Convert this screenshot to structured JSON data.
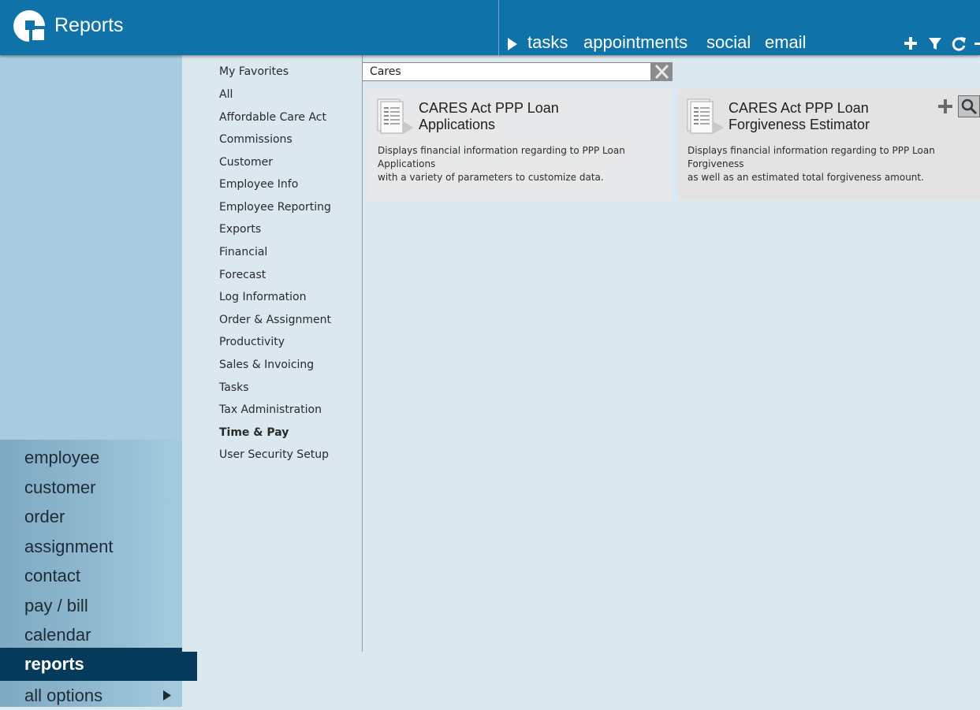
{
  "header": {
    "title": "Reports",
    "links": [
      "tasks",
      "appointments",
      "social",
      "email"
    ],
    "icons": [
      "play-icon",
      "plus-icon",
      "filter-icon",
      "refresh-icon"
    ]
  },
  "nav": {
    "items": [
      {
        "label": "employee"
      },
      {
        "label": "customer"
      },
      {
        "label": "order"
      },
      {
        "label": "assignment"
      },
      {
        "label": "contact"
      },
      {
        "label": "pay / bill"
      },
      {
        "label": "calendar"
      },
      {
        "label": "reports",
        "active": true
      },
      {
        "label": "all options"
      }
    ]
  },
  "categories": [
    "My Favorites",
    "All",
    "Affordable Care Act",
    "Commissions",
    "Customer",
    "Employee Info",
    "Employee Reporting",
    "Exports",
    "Financial",
    "Forecast",
    "Log Information",
    "Order & Assignment",
    "Productivity",
    "Sales & Invoicing",
    "Tasks",
    "Tax Administration",
    "Time & Pay",
    "User Security Setup"
  ],
  "selected_category": "Time & Pay",
  "search": {
    "value": "Cares"
  },
  "reports": [
    {
      "title_line1": "CARES Act PPP Loan",
      "title_line2": "Applications",
      "description_line1": "Displays financial information regarding to PPP Loan Applications",
      "description_line2": "with a variety of parameters to customize data."
    },
    {
      "title_line1": "CARES Act PPP Loan",
      "title_line2": "Forgiveness Estimator",
      "description_line1": "Displays financial information regarding to PPP Loan Forgiveness",
      "description_line2": "as well as an estimated total forgiveness amount."
    }
  ],
  "colors": {
    "header": "#0f72a8",
    "active_nav": "#063a5b",
    "content_bg": "#dce9f0"
  }
}
